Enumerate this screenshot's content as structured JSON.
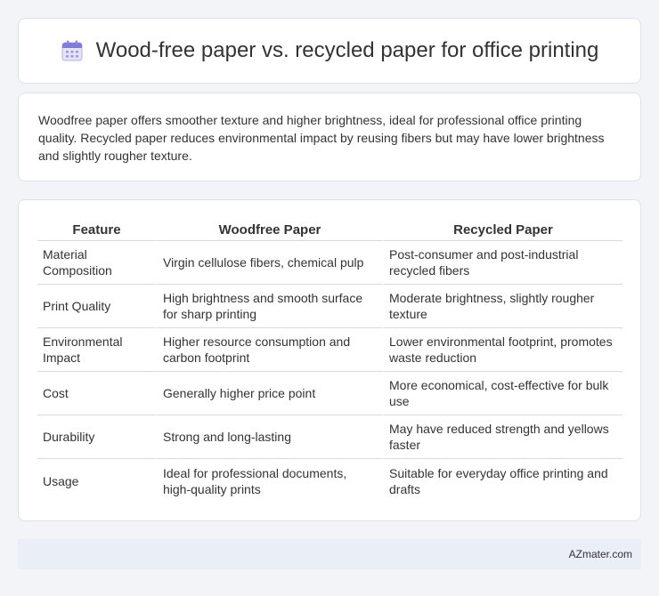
{
  "header": {
    "icon": "calendar-icon",
    "title": "Wood-free paper vs. recycled paper for office printing"
  },
  "description": "Woodfree paper offers smoother texture and higher brightness, ideal for professional office printing quality. Recycled paper reduces environmental impact by reusing fibers but may have lower brightness and slightly rougher texture.",
  "table": {
    "headers": [
      "Feature",
      "Woodfree Paper",
      "Recycled Paper"
    ],
    "rows": [
      [
        "Material Composition",
        "Virgin cellulose fibers, chemical pulp",
        "Post-consumer and post-industrial recycled fibers"
      ],
      [
        "Print Quality",
        "High brightness and smooth surface for sharp printing",
        "Moderate brightness, slightly rougher texture"
      ],
      [
        "Environmental Impact",
        "Higher resource consumption and carbon footprint",
        "Lower environmental footprint, promotes waste reduction"
      ],
      [
        "Cost",
        "Generally higher price point",
        "More economical, cost-effective for bulk use"
      ],
      [
        "Durability",
        "Strong and long-lasting",
        "May have reduced strength and yellows faster"
      ],
      [
        "Usage",
        "Ideal for professional documents, high-quality prints",
        "Suitable for everyday office printing and drafts"
      ]
    ]
  },
  "footer": {
    "brand": "AZmater.com"
  }
}
